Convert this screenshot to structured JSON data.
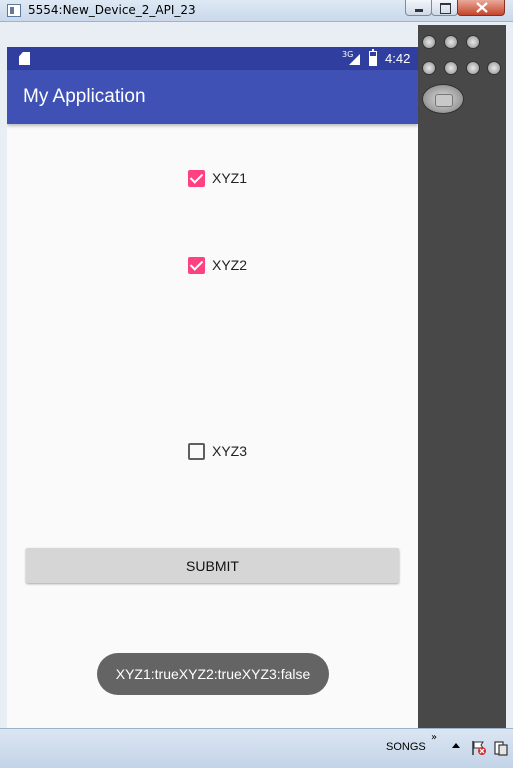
{
  "window": {
    "title": "5554:New_Device_2_API_23"
  },
  "status_bar": {
    "network": "3G",
    "time": "4:42"
  },
  "app_bar": {
    "title": "My Application"
  },
  "checkboxes": [
    {
      "label": "XYZ1",
      "checked": true
    },
    {
      "label": "XYZ2",
      "checked": true
    },
    {
      "label": "XYZ3",
      "checked": false
    }
  ],
  "submit_button": {
    "label": "SUBMIT"
  },
  "toast": {
    "message": "XYZ1:trueXYZ2:trueXYZ3:false"
  },
  "taskbar": {
    "tray_label": "SONGS",
    "chevron": "»"
  },
  "colors": {
    "status_bar": "#303f9f",
    "app_bar": "#3f51b5",
    "accent": "#ff4081",
    "toast": "#646464"
  },
  "icons": [
    "sd-card-icon",
    "signal-icon",
    "battery-icon",
    "back-icon",
    "home-icon",
    "recents-icon",
    "flag-icon",
    "device-icon"
  ]
}
